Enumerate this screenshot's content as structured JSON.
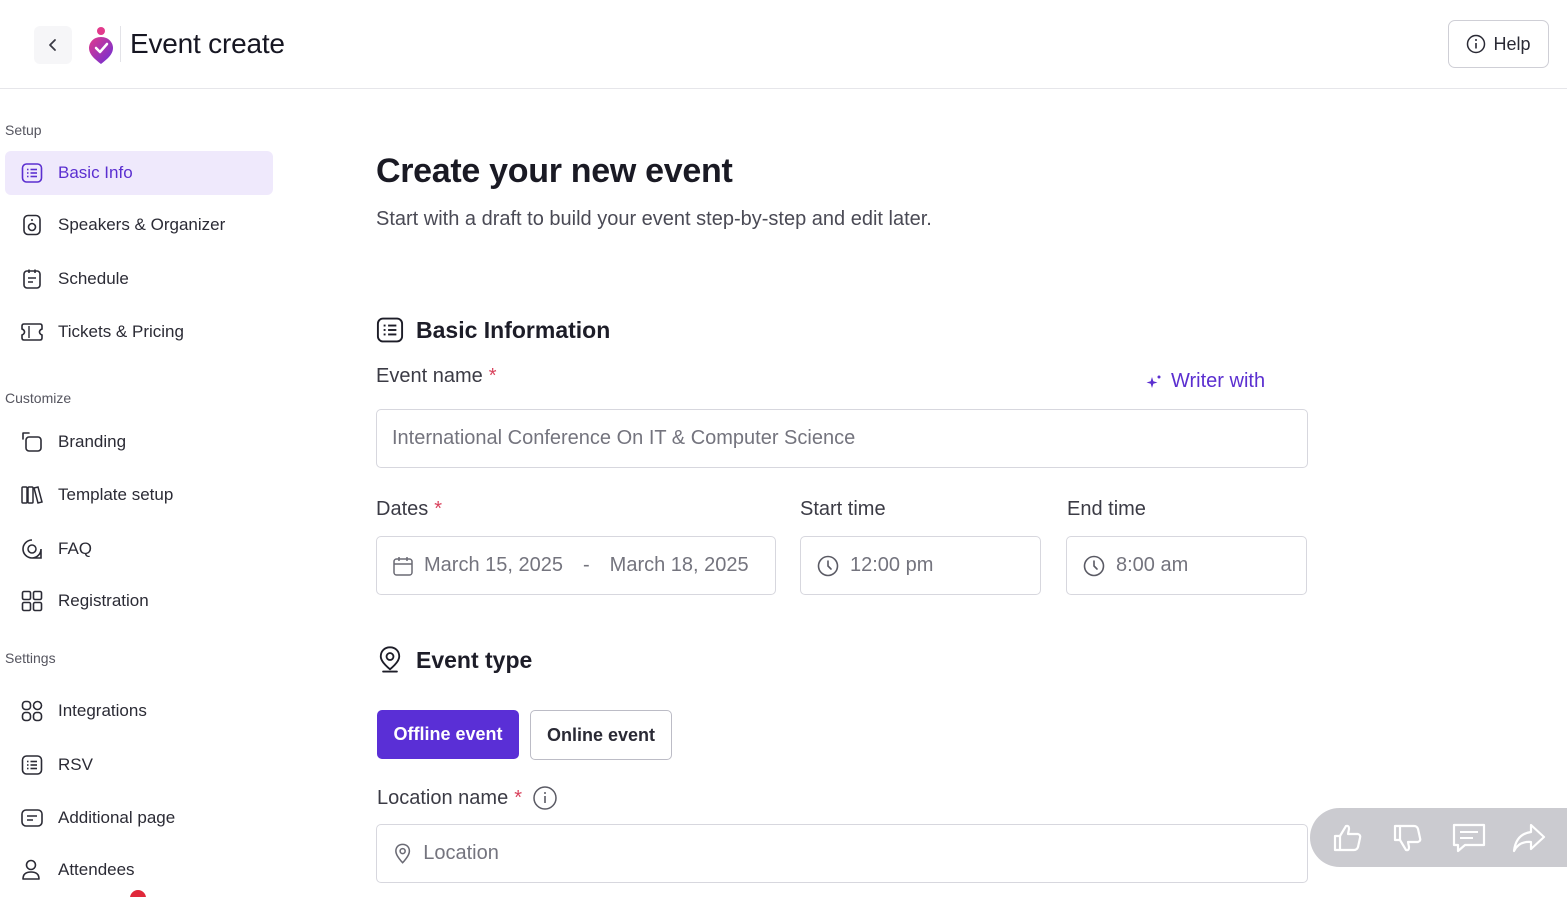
{
  "header": {
    "title": "Event create",
    "help_label": "Help"
  },
  "sidebar": {
    "sections": [
      {
        "label": "Setup"
      },
      {
        "label": "Customize"
      },
      {
        "label": "Settings"
      }
    ],
    "items": [
      {
        "label": "Basic Info",
        "icon": "list-icon",
        "active": true
      },
      {
        "label": "Speakers & Organizer",
        "icon": "speaker-icon"
      },
      {
        "label": "Schedule",
        "icon": "schedule-icon"
      },
      {
        "label": "Tickets & Pricing",
        "icon": "ticket-icon"
      },
      {
        "label": "Branding",
        "icon": "branding-icon"
      },
      {
        "label": "Template setup",
        "icon": "template-icon"
      },
      {
        "label": "FAQ",
        "icon": "faq-icon"
      },
      {
        "label": "Registration",
        "icon": "registration-icon"
      },
      {
        "label": "Integrations",
        "icon": "integrations-icon"
      },
      {
        "label": "RSV",
        "icon": "rsv-icon"
      },
      {
        "label": "Additional page",
        "icon": "page-icon"
      },
      {
        "label": "Attendees",
        "icon": "attendees-icon"
      }
    ]
  },
  "main": {
    "title": "Create your new event",
    "subtitle": "Start with a draft to build your event step-by-step and edit later.",
    "basic_info_heading": "Basic Information",
    "event_name_label": "Event name",
    "required_mark": "*",
    "writer_label": "Writer with",
    "event_name_value": "International Conference On IT & Computer Science",
    "dates_label": "Dates",
    "start_date": "March 15, 2025",
    "date_separator": "-",
    "end_date": "March 18, 2025",
    "start_time_label": "Start time",
    "start_time_value": "12:00 pm",
    "end_time_label": "End time",
    "end_time_value": "8:00 am",
    "event_type_heading": "Event type",
    "offline_label": "Offline event",
    "online_label": "Online event",
    "location_label": "Location name",
    "location_placeholder": "Location"
  },
  "colors": {
    "accent": "#5a2fd6",
    "active_bg": "#efe9fc",
    "required": "#d9435d"
  }
}
